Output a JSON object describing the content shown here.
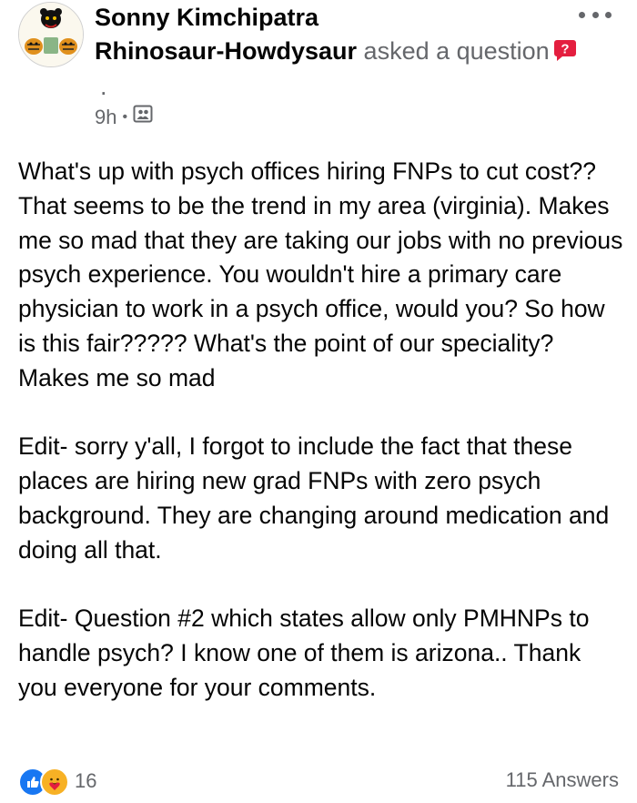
{
  "post": {
    "author": "Sonny Kimchipatra",
    "group": "Rhinosaur-Howdysaur",
    "action": " asked a question",
    "action_end": ".",
    "time": "9h",
    "separator": "•",
    "body": [
      "What's up with psych offices hiring FNPs to cut cost?? That seems to be the trend in my area (virginia). Makes me so mad that they are taking our jobs with no previous psych experience. You wouldn't hire a primary care physician to work in a psych office, would you? So how is this fair????? What's the point of our speciality? Makes me so mad",
      "Edit- sorry y'all, I forgot to include the fact that these places are hiring new grad FNPs with zero psych background. They are changing around medication and doing all that.",
      "Edit- Question #2 which states allow only PMHNPs to handle psych? I know one of them is arizona.. Thank you everyone for your comments."
    ]
  },
  "footer": {
    "reaction_count": "16",
    "answers": "115 Answers"
  },
  "icons": {
    "more": "more-options-icon",
    "question": "question-badge-icon",
    "audience": "group-audience-icon",
    "like": "like-reaction-icon",
    "care": "care-reaction-icon"
  },
  "colors": {
    "primary_text": "#050505",
    "secondary_text": "#65676b",
    "like_blue": "#1877f2",
    "question_red": "#e41e3f",
    "care_yellow": "#f7b125"
  }
}
